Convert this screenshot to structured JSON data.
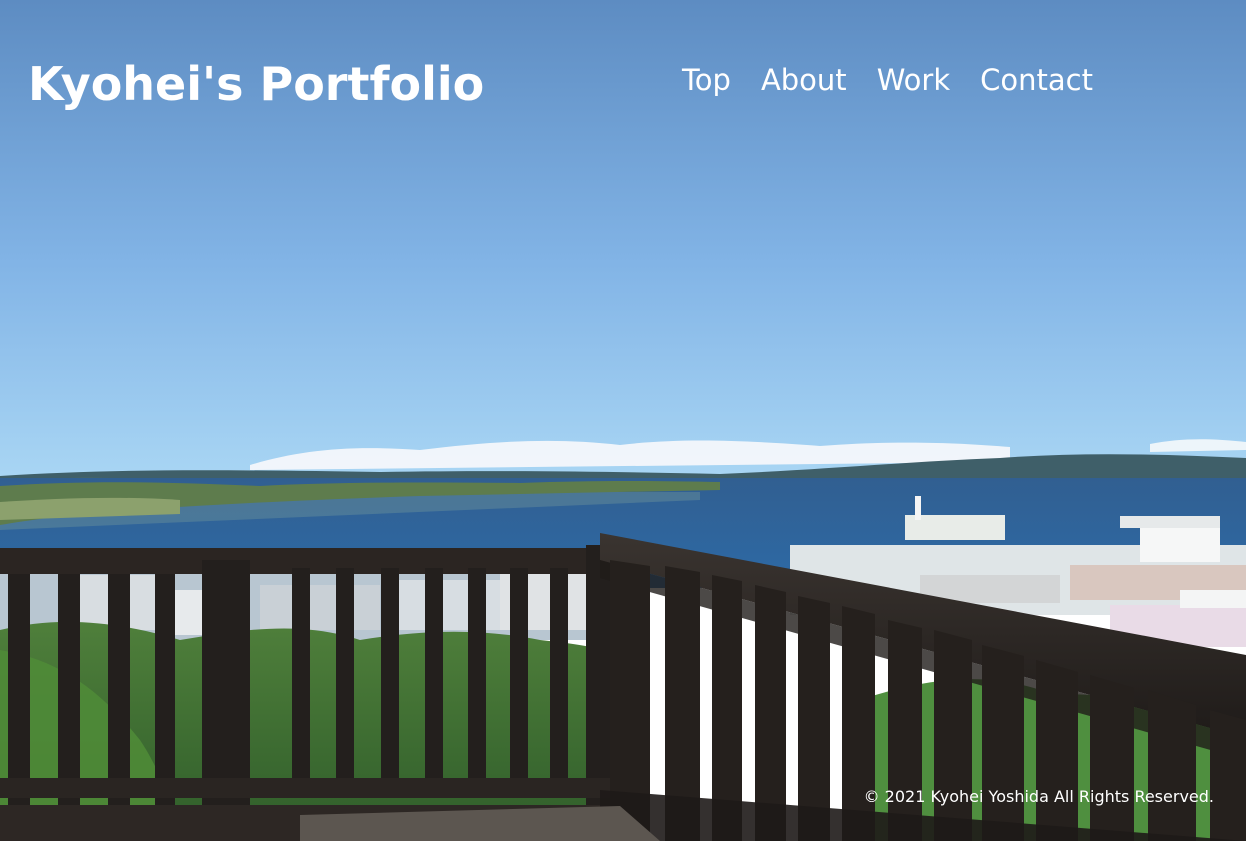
{
  "header": {
    "site_title": "Kyohei's Portfolio"
  },
  "nav": {
    "items": [
      {
        "label": "Top"
      },
      {
        "label": "About"
      },
      {
        "label": "Work"
      },
      {
        "label": "Contact"
      }
    ]
  },
  "hero": {
    "image_name": "seaside-observation-deck-photo"
  },
  "footer": {
    "copyright": "© 2021 Kyohei Yoshida All Rights Reserved."
  },
  "colors": {
    "text": "#ffffff",
    "sky_top": "#5f8fc4",
    "sky_bottom": "#9fd0f2",
    "sea": "#2f5f93",
    "railing": "#2a2421"
  }
}
